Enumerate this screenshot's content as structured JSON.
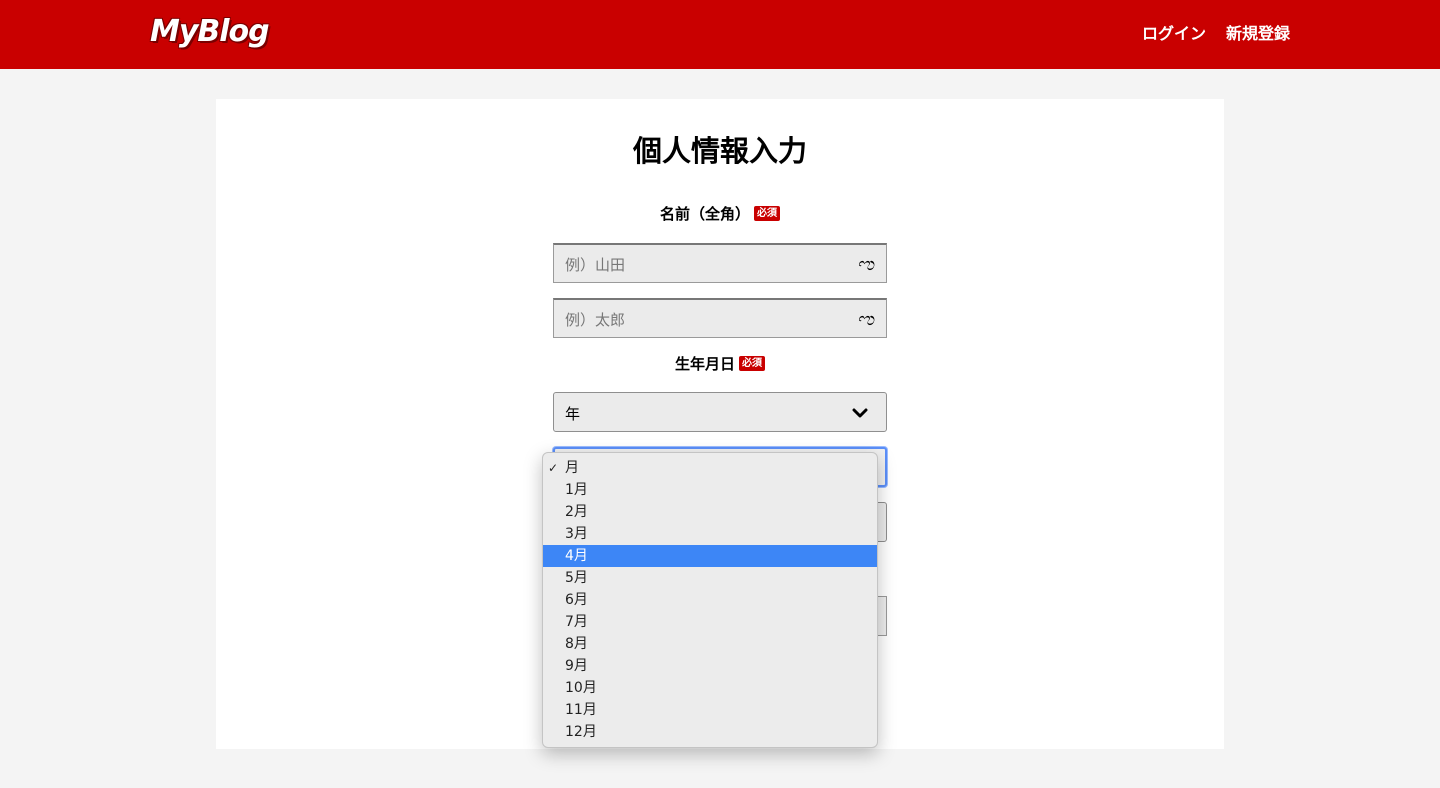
{
  "header": {
    "logo": "MyBlog",
    "nav": {
      "login": "ログイン",
      "signup": "新規登録"
    }
  },
  "form": {
    "title": "個人情報入力",
    "name_label": "名前（全角）",
    "required_badge": "必須",
    "last_name_placeholder": "例）山田",
    "first_name_placeholder": "例）太郎",
    "birthday_label": "生年月日",
    "year_select_value": "年",
    "month_select_value": "月"
  },
  "dropdown": {
    "options": [
      "月",
      "1月",
      "2月",
      "3月",
      "4月",
      "5月",
      "6月",
      "7月",
      "8月",
      "9月",
      "10月",
      "11月",
      "12月"
    ],
    "checked_index": 0,
    "highlighted_index": 4
  },
  "colors": {
    "header": "#c90000",
    "highlight": "#3d86f6",
    "focus": "#5b8ff9"
  }
}
